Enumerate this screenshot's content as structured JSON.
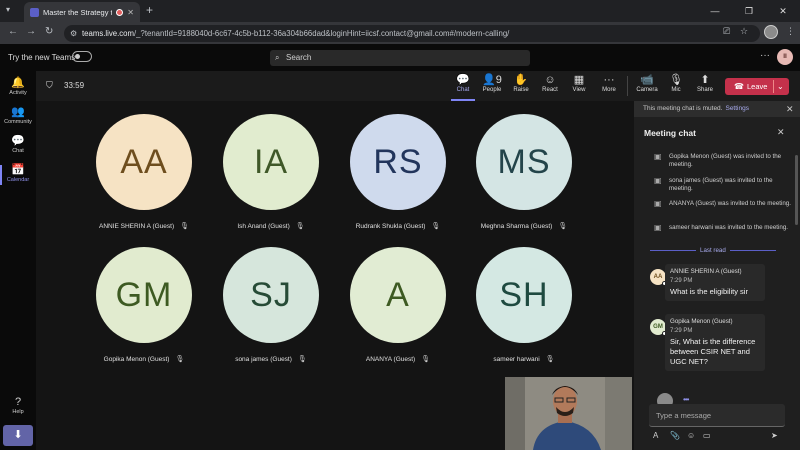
{
  "browser": {
    "tab_title": "Master the Strategy to Cra",
    "new_tab": "+",
    "url_host": "teams.live.com",
    "url_rest": "/_?tenantId=9188040d-6c67-4c5b-b112-36a304b66dad&loginHint=iicsf.contact@gmail.com#/modern-calling/"
  },
  "teams": {
    "try_new": "Try the new Teams",
    "search_placeholder": "Search",
    "avatar_initials": "II"
  },
  "rail": [
    {
      "label": "Activity",
      "icon": "bell-icon",
      "glyph": "🔔"
    },
    {
      "label": "Community",
      "icon": "community-icon",
      "glyph": "👥"
    },
    {
      "label": "Chat",
      "icon": "chat-icon",
      "glyph": "💬"
    },
    {
      "label": "Calendar",
      "icon": "calendar-icon",
      "glyph": "📅"
    },
    {
      "label": "Help",
      "icon": "help-icon",
      "glyph": "?"
    }
  ],
  "meeting": {
    "timer": "33:59",
    "toolbar": [
      {
        "label": "Chat",
        "glyph": "💬"
      },
      {
        "label": "People",
        "glyph": "👤9"
      },
      {
        "label": "Raise",
        "glyph": "✋"
      },
      {
        "label": "React",
        "glyph": "☺"
      },
      {
        "label": "View",
        "glyph": "▦"
      },
      {
        "label": "More",
        "glyph": "···"
      },
      {
        "label": "Camera",
        "glyph": "📹"
      },
      {
        "label": "Mic",
        "glyph": "🎙"
      },
      {
        "label": "Share",
        "glyph": "⬆"
      }
    ],
    "leave_label": "Leave",
    "participants": [
      {
        "initials": "AA",
        "name": "ANNIE SHERIN A (Guest)",
        "bg": "#f6e3c4",
        "fg": "#6e4e1e"
      },
      {
        "initials": "IA",
        "name": "Ish Anand (Guest)",
        "bg": "#e1eccf",
        "fg": "#3f5828"
      },
      {
        "initials": "RS",
        "name": "Rudrank Shukla (Guest)",
        "bg": "#cfdaed",
        "fg": "#22355c"
      },
      {
        "initials": "MS",
        "name": "Meghna Sharma (Guest)",
        "bg": "#d4e5e4",
        "fg": "#23444a"
      },
      {
        "initials": "GM",
        "name": "Gopika Menon (Guest)",
        "bg": "#e1ebcf",
        "fg": "#3d5a22"
      },
      {
        "initials": "SJ",
        "name": "sona james (Guest)",
        "bg": "#d6e6dc",
        "fg": "#264b36"
      },
      {
        "initials": "A",
        "name": "ANANYA (Guest)",
        "bg": "#e1ecd3",
        "fg": "#3d5a22"
      },
      {
        "initials": "SH",
        "name": "sameer harwani",
        "bg": "#d4e8e3",
        "fg": "#1e4a40"
      }
    ]
  },
  "chat": {
    "muted_notice": "This meeting chat is muted.",
    "settings_link": "Settings",
    "title": "Meeting chat",
    "system_messages": [
      "Gopika Menon (Guest) was invited to the meeting.",
      "sona james (Guest) was invited to the meeting.",
      "ANANYA (Guest) was invited to the meeting.",
      "sameer harwani was invited to the meeting."
    ],
    "last_read": "Last read",
    "messages": [
      {
        "initials": "AA",
        "author": "ANNIE SHERIN A (Guest)",
        "time": "7:29 PM",
        "text": "What is the eligibility sir",
        "bg": "#f6e3c4",
        "fg": "#6e4e1e"
      },
      {
        "initials": "GM",
        "author": "Gopika Menon (Guest)",
        "time": "7:29 PM",
        "text": "Sir, What is the difference between CSIR NET and UGC NET?",
        "bg": "#e1ebcf",
        "fg": "#3d5a22"
      }
    ],
    "compose_placeholder": "Type a message"
  }
}
